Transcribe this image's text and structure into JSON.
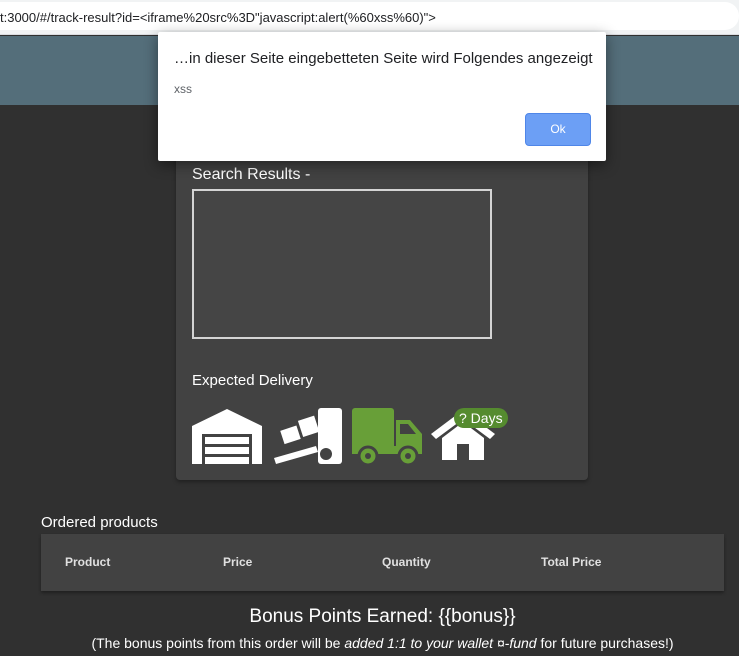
{
  "browser": {
    "url": "t:3000/#/track-result?id=<iframe%20src%3D\"javascript:alert(%60xss%60)\">"
  },
  "dialog": {
    "title": "…in dieser Seite eingebetteten Seite wird Folgendes angezeigt",
    "message": "xss",
    "ok_label": "Ok"
  },
  "tracking": {
    "search_results_label": "Search Results -",
    "expected_delivery_label": "Expected Delivery",
    "days_badge": "? Days",
    "icons": [
      "warehouse-icon",
      "dolly-icon",
      "truck-icon",
      "home-icon"
    ],
    "active_color": "#689f38"
  },
  "orders": {
    "title": "Ordered products",
    "columns": [
      "Product",
      "Price",
      "Quantity",
      "Total Price"
    ]
  },
  "bonus": {
    "heading": "Bonus Points Earned: {{bonus}}",
    "note_prefix": "(The bonus points from this order will be ",
    "note_em": "added 1:1 to your wallet ¤-fund",
    "note_suffix": " for future purchases!)"
  }
}
